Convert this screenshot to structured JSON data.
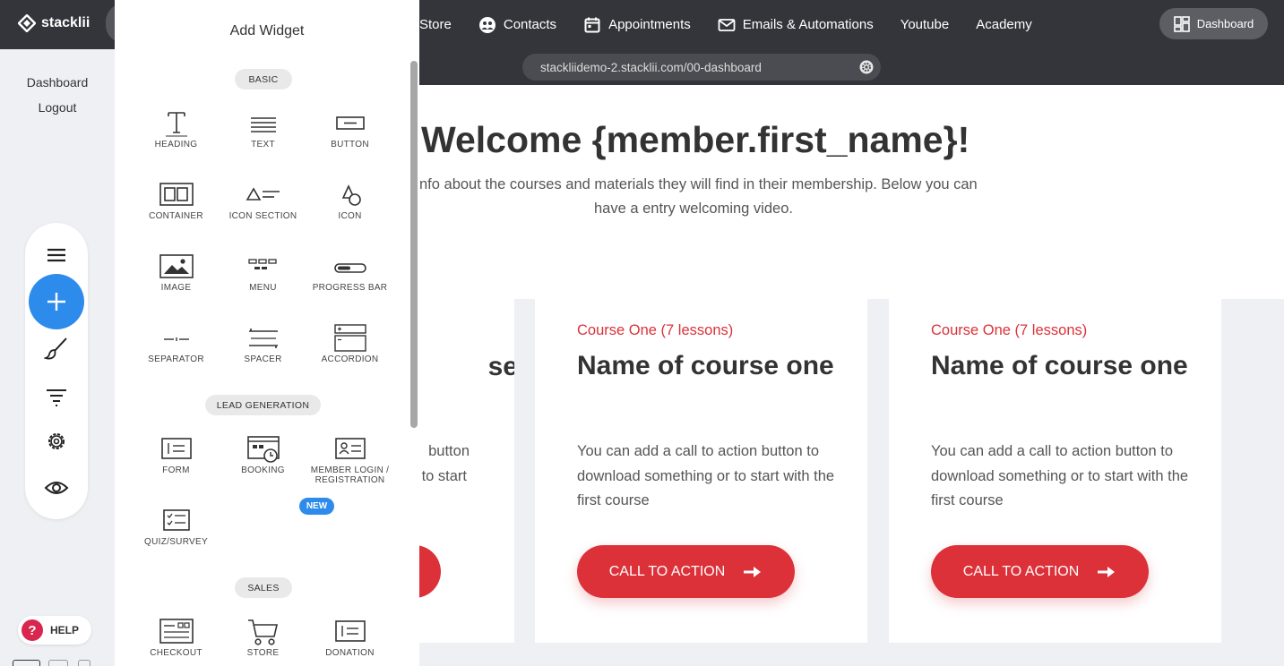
{
  "brand": {
    "name": "stacklii"
  },
  "nav": {
    "items": [
      {
        "label": "Store",
        "icon": "store-icon"
      },
      {
        "label": "Contacts",
        "icon": "contacts-icon"
      },
      {
        "label": "Appointments",
        "icon": "calendar-icon"
      },
      {
        "label": "Emails & Automations",
        "icon": "email-icon"
      },
      {
        "label": "Youtube",
        "icon": ""
      },
      {
        "label": "Academy",
        "icon": ""
      }
    ],
    "dashboard_button": "Dashboard"
  },
  "urlbar": {
    "url": "stackliidemo-2.stacklii.com/00-dashboard"
  },
  "leftbar": {
    "dashboard_link": "Dashboard",
    "logout_link": "Logout"
  },
  "help": {
    "label": "HELP",
    "icon_glyph": "?"
  },
  "panel": {
    "title": "Add Widget",
    "sections": {
      "basic": "BASIC",
      "lead": "LEAD GENERATION",
      "sales": "SALES"
    },
    "widgets": {
      "heading": "HEADING",
      "text": "TEXT",
      "button": "BUTTON",
      "container": "CONTAINER",
      "icon_section": "ICON SECTION",
      "icon": "ICON",
      "image": "IMAGE",
      "menu": "MENU",
      "progress_bar": "PROGRESS BAR",
      "separator": "SEPARATOR",
      "spacer": "SPACER",
      "accordion": "ACCORDION",
      "form": "FORM",
      "booking": "BOOKING",
      "member_login_1": "MEMBER LOGIN /",
      "member_login_2": "REGISTRATION",
      "quiz": "QUIZ/SURVEY",
      "checkout": "CHECKOUT",
      "store": "STORE",
      "donation": "DONATION"
    },
    "new_badge": "NEW"
  },
  "content": {
    "welcome": "Welcome {member.first_name}!",
    "intro_line1": "nfo about the courses and materials they will find in their membership. Below you can",
    "intro_line2": "have a entry welcoming video.",
    "partial": {
      "title": "se",
      "body_line1": "button",
      "body_line2": "to start"
    },
    "cards": [
      {
        "subtitle": "Course One (7 lessons)",
        "title": "Name of course one",
        "body": "You can add a call to action button to download something or to start with the first course",
        "cta": "CALL TO ACTION"
      },
      {
        "subtitle": "Course One (7 lessons)",
        "title": "Name of course one",
        "body": "You can add a call to action button to download something or to start with the first course",
        "cta": "CALL TO ACTION"
      }
    ]
  },
  "colors": {
    "nav_bg": "#33353b",
    "accent_blue": "#2d8ceb",
    "cta_red": "#dc3139",
    "subtitle_red": "#d9323a",
    "help_red": "#d8264f"
  }
}
